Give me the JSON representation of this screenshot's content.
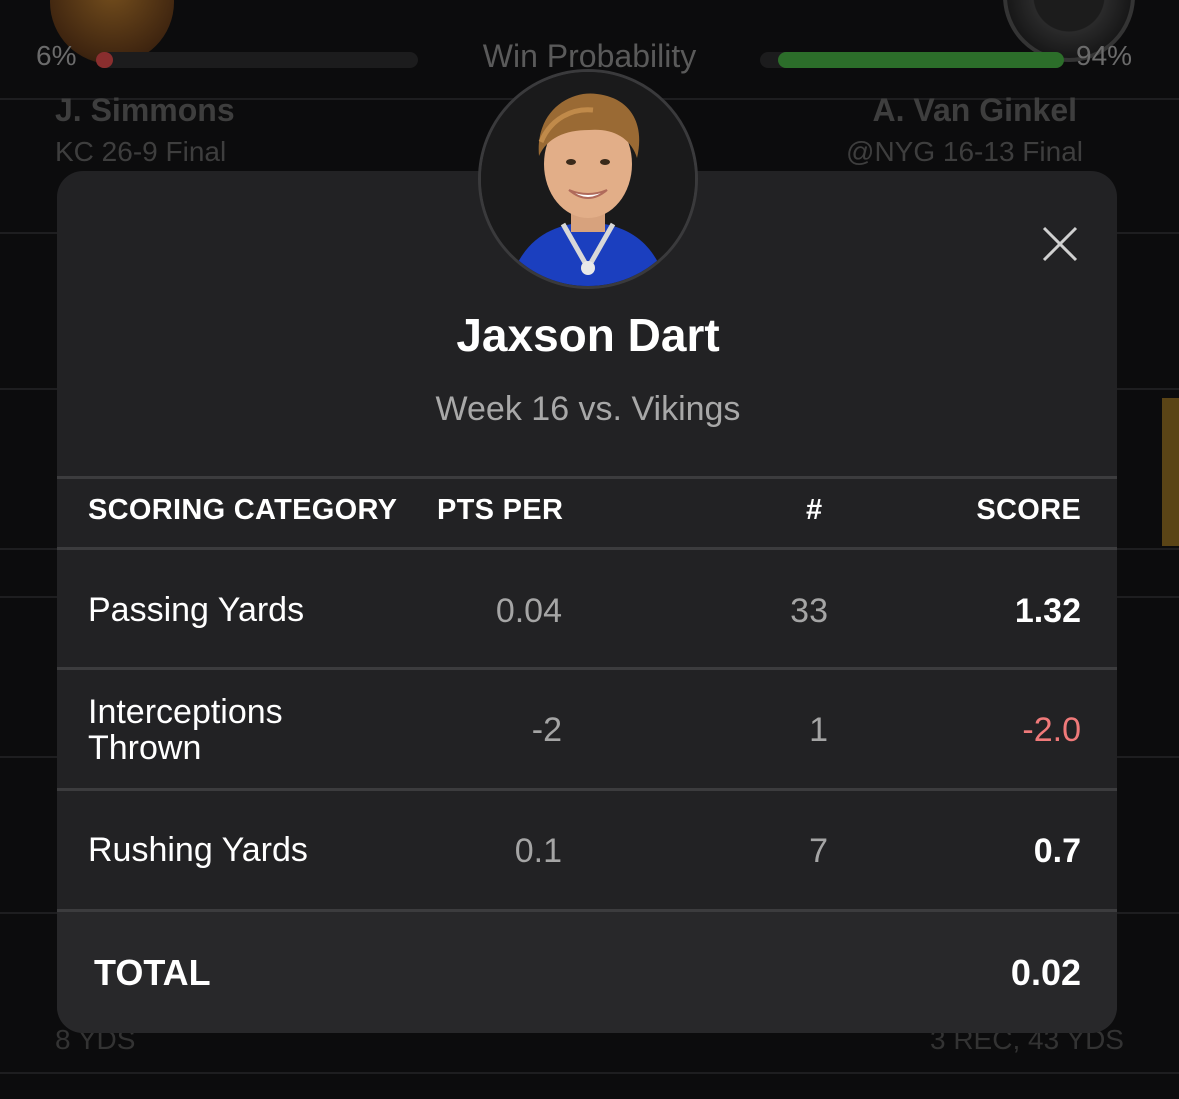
{
  "background": {
    "win_probability_label": "Win Probability",
    "left_pct": "6%",
    "right_pct": "94%",
    "left_fill": 0.06,
    "right_fill": 0.94,
    "left_player": {
      "name": "J. Simmons",
      "line": "KC 26-9 Final"
    },
    "right_player": {
      "name": "A. Van Ginkel",
      "line": "@NYG 16-13 Final"
    },
    "footer_left": "8 YDS",
    "footer_right": "3 REC, 43 YDS"
  },
  "modal": {
    "player_name": "Jaxson Dart",
    "subtitle": "Week 16 vs. Vikings",
    "headers": {
      "category": "SCORING CATEGORY",
      "pts_per": "PTS PER",
      "count": "#",
      "score": "SCORE"
    },
    "rows": [
      {
        "category": "Passing Yards",
        "pts_per": "0.04",
        "count": "33",
        "score": "1.32",
        "score_color": "#ffffff"
      },
      {
        "category_line1": "Interceptions",
        "category_line2": "Thrown",
        "pts_per": "-2",
        "count": "1",
        "score": "-2.0",
        "score_color": "#f07a7a"
      },
      {
        "category": "Rushing Yards",
        "pts_per": "0.1",
        "count": "7",
        "score": "0.7",
        "score_color": "#ffffff"
      }
    ],
    "total_label": "TOTAL",
    "total_score": "0.02",
    "icons": {
      "close": "close-icon",
      "avatar": "player-headshot"
    }
  }
}
